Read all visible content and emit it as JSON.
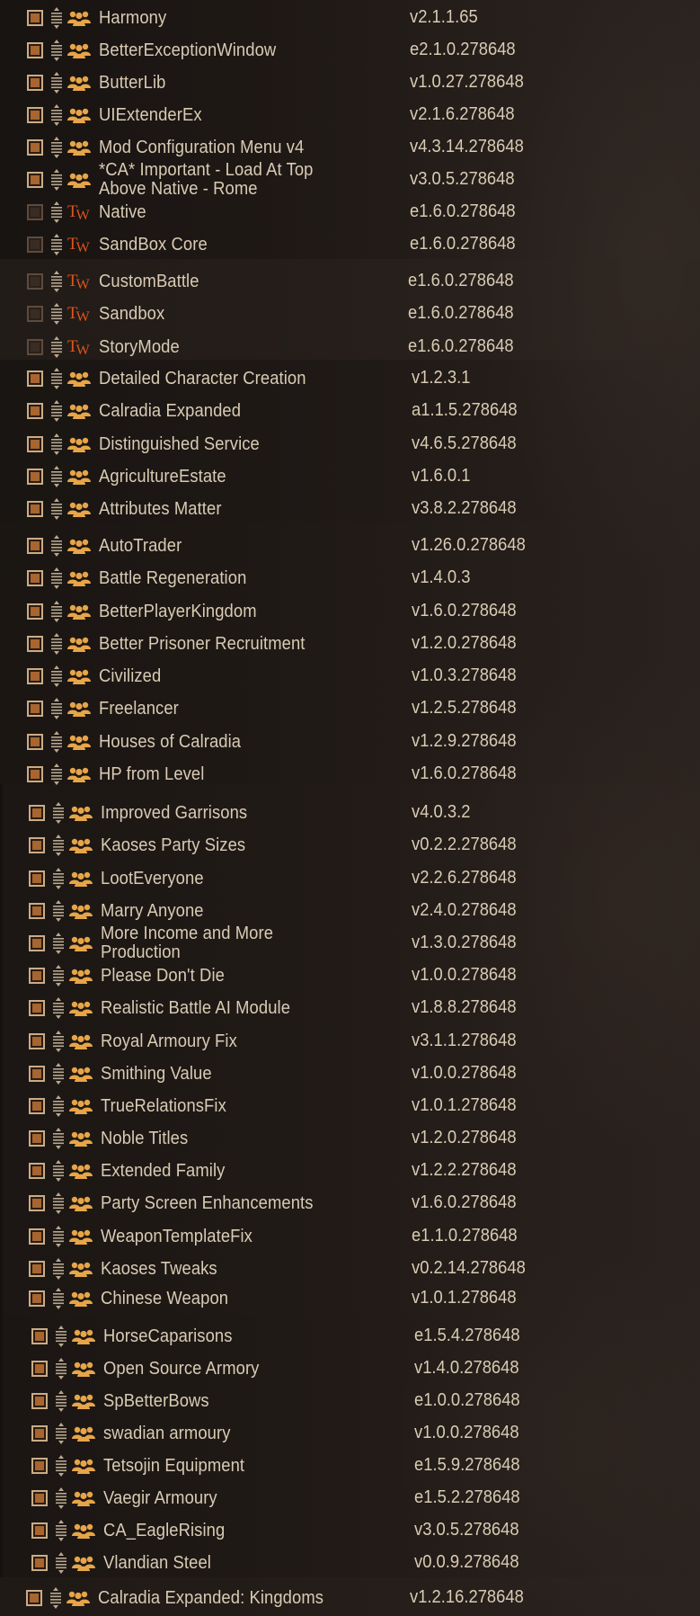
{
  "colors": {
    "text": "#d9cbb4",
    "checkbox_enabled_fill": "#a8652f",
    "checkbox_enabled_border": "#c9ac87",
    "checkbox_disabled_fill": "#3a2c22",
    "community_icon": "#e7a548",
    "official_icon": "#e0541c"
  },
  "mods": [
    {
      "name": "Harmony",
      "version": "v2.1.1.65",
      "checked": true,
      "source": "community-icon"
    },
    {
      "name": "BetterExceptionWindow",
      "version": "e2.1.0.278648",
      "checked": true,
      "source": "community-icon"
    },
    {
      "name": "ButterLib",
      "version": "v1.0.27.278648",
      "checked": true,
      "source": "community-icon"
    },
    {
      "name": "UIExtenderEx",
      "version": "v2.1.6.278648",
      "checked": true,
      "source": "community-icon"
    },
    {
      "name": "Mod Configuration Menu v4",
      "version": "v4.3.14.278648",
      "checked": true,
      "source": "community-icon"
    },
    {
      "name": "*CA* Important - Load At Top Above Native - Rome",
      "version": "v3.0.5.278648",
      "checked": true,
      "source": "community-icon"
    },
    {
      "name": "Native",
      "version": "e1.6.0.278648",
      "checked": false,
      "source": "taleworlds-icon"
    },
    {
      "name": "SandBox Core",
      "version": "e1.6.0.278648",
      "checked": false,
      "source": "taleworlds-icon"
    },
    {
      "name": "CustomBattle",
      "version": "e1.6.0.278648",
      "checked": false,
      "source": "taleworlds-icon"
    },
    {
      "name": "Sandbox",
      "version": "e1.6.0.278648",
      "checked": false,
      "source": "taleworlds-icon"
    },
    {
      "name": "StoryMode",
      "version": "e1.6.0.278648",
      "checked": false,
      "source": "taleworlds-icon"
    },
    {
      "name": "Detailed Character Creation",
      "version": "v1.2.3.1",
      "checked": true,
      "source": "community-icon"
    },
    {
      "name": "Calradia Expanded",
      "version": "a1.1.5.278648",
      "checked": true,
      "source": "community-icon"
    },
    {
      "name": "Distinguished Service",
      "version": "v4.6.5.278648",
      "checked": true,
      "source": "community-icon"
    },
    {
      "name": "AgricultureEstate",
      "version": "v1.6.0.1",
      "checked": true,
      "source": "community-icon"
    },
    {
      "name": "Attributes Matter",
      "version": "v3.8.2.278648",
      "checked": true,
      "source": "community-icon"
    },
    {
      "name": "AutoTrader",
      "version": "v1.26.0.278648",
      "checked": true,
      "source": "community-icon"
    },
    {
      "name": "Battle Regeneration",
      "version": "v1.4.0.3",
      "checked": true,
      "source": "community-icon"
    },
    {
      "name": "BetterPlayerKingdom",
      "version": "v1.6.0.278648",
      "checked": true,
      "source": "community-icon"
    },
    {
      "name": "Better Prisoner Recruitment",
      "version": "v1.2.0.278648",
      "checked": true,
      "source": "community-icon"
    },
    {
      "name": "Civilized",
      "version": "v1.0.3.278648",
      "checked": true,
      "source": "community-icon"
    },
    {
      "name": "Freelancer",
      "version": "v1.2.5.278648",
      "checked": true,
      "source": "community-icon"
    },
    {
      "name": "Houses of Calradia",
      "version": "v1.2.9.278648",
      "checked": true,
      "source": "community-icon"
    },
    {
      "name": "HP from Level",
      "version": "v1.6.0.278648",
      "checked": true,
      "source": "community-icon"
    },
    {
      "name": "Improved Garrisons",
      "version": "v4.0.3.2",
      "checked": true,
      "source": "community-icon"
    },
    {
      "name": "Kaoses Party Sizes",
      "version": "v0.2.2.278648",
      "checked": true,
      "source": "community-icon"
    },
    {
      "name": "LootEveryone",
      "version": "v2.2.6.278648",
      "checked": true,
      "source": "community-icon"
    },
    {
      "name": "Marry Anyone",
      "version": "v2.4.0.278648",
      "checked": true,
      "source": "community-icon"
    },
    {
      "name": "More Income and More Production",
      "version": "v1.3.0.278648",
      "checked": true,
      "source": "community-icon"
    },
    {
      "name": "Please Don't Die",
      "version": "v1.0.0.278648",
      "checked": true,
      "source": "community-icon"
    },
    {
      "name": "Realistic Battle AI Module",
      "version": "v1.8.8.278648",
      "checked": true,
      "source": "community-icon"
    },
    {
      "name": "Royal Armoury Fix",
      "version": "v3.1.1.278648",
      "checked": true,
      "source": "community-icon"
    },
    {
      "name": "Smithing Value",
      "version": "v1.0.0.278648",
      "checked": true,
      "source": "community-icon"
    },
    {
      "name": "TrueRelationsFix",
      "version": "v1.0.1.278648",
      "checked": true,
      "source": "community-icon"
    },
    {
      "name": "Noble Titles",
      "version": "v1.2.0.278648",
      "checked": true,
      "source": "community-icon"
    },
    {
      "name": "Extended Family",
      "version": "v1.2.2.278648",
      "checked": true,
      "source": "community-icon"
    },
    {
      "name": "Party Screen Enhancements",
      "version": "v1.6.0.278648",
      "checked": true,
      "source": "community-icon"
    },
    {
      "name": "WeaponTemplateFix",
      "version": "e1.1.0.278648",
      "checked": true,
      "source": "community-icon"
    },
    {
      "name": "Kaoses Tweaks",
      "version": "v0.2.14.278648",
      "checked": true,
      "source": "community-icon"
    },
    {
      "name": "Chinese Weapon",
      "version": "v1.0.1.278648",
      "checked": true,
      "source": "community-icon"
    },
    {
      "name": "HorseCaparisons",
      "version": "e1.5.4.278648",
      "checked": true,
      "source": "community-icon"
    },
    {
      "name": "Open Source Armory",
      "version": "v1.4.0.278648",
      "checked": true,
      "source": "community-icon"
    },
    {
      "name": "SpBetterBows",
      "version": "e1.0.0.278648",
      "checked": true,
      "source": "community-icon"
    },
    {
      "name": "swadian armoury",
      "version": "v1.0.0.278648",
      "checked": true,
      "source": "community-icon"
    },
    {
      "name": "Tetsojin Equipment",
      "version": "e1.5.9.278648",
      "checked": true,
      "source": "community-icon"
    },
    {
      "name": "Vaegir Armoury",
      "version": "e1.5.2.278648",
      "checked": true,
      "source": "community-icon"
    },
    {
      "name": "CA_EagleRising",
      "version": "v3.0.5.278648",
      "checked": true,
      "source": "community-icon"
    },
    {
      "name": "Vlandian Steel",
      "version": "v0.0.9.278648",
      "checked": true,
      "source": "community-icon"
    },
    {
      "name": "Calradia Expanded: Kingdoms",
      "version": "v1.2.16.278648",
      "checked": true,
      "source": "community-icon"
    }
  ]
}
